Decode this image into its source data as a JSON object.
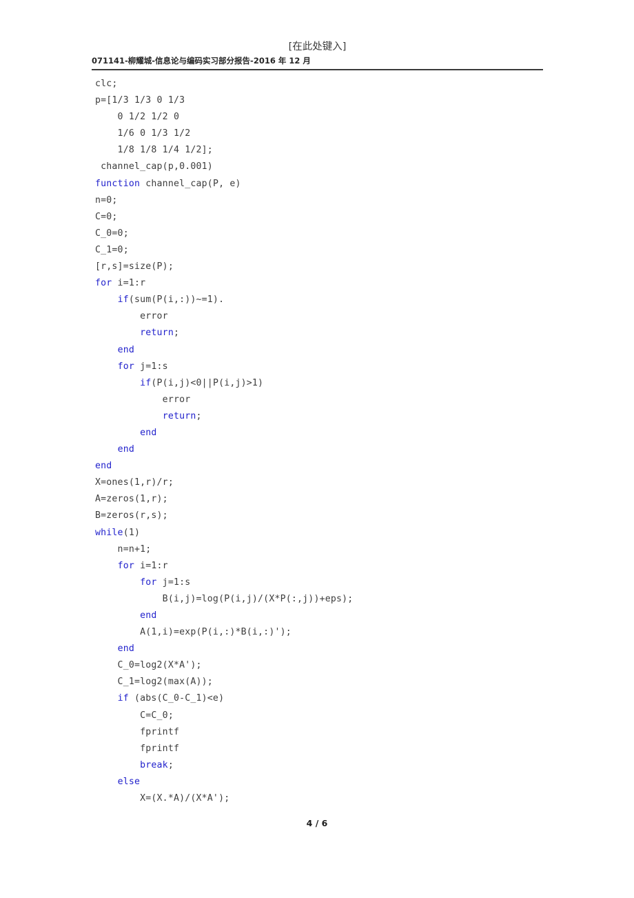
{
  "header": {
    "center_text": "[在此处键入]",
    "title_line": "071141-柳耀城-信息论与编码实习部分报告-2016 年 12 月"
  },
  "footer": {
    "page_indicator": "4 / 6"
  },
  "colors": {
    "keyword": "#2222cc",
    "text": "#3d3d3d",
    "rule": "#3a3a3a"
  },
  "code": {
    "language": "matlab",
    "lines": [
      {
        "indent": 0,
        "tokens": [
          {
            "t": "plain",
            "v": "clc;"
          }
        ]
      },
      {
        "indent": 0,
        "tokens": [
          {
            "t": "plain",
            "v": "p=[1/3 1/3 0 1/3"
          }
        ]
      },
      {
        "indent": 0,
        "tokens": [
          {
            "t": "plain",
            "v": "    0 1/2 1/2 0"
          }
        ]
      },
      {
        "indent": 0,
        "tokens": [
          {
            "t": "plain",
            "v": "    1/6 0 1/3 1/2"
          }
        ]
      },
      {
        "indent": 0,
        "tokens": [
          {
            "t": "plain",
            "v": "    1/8 1/8 1/4 1/2];"
          }
        ]
      },
      {
        "indent": 0,
        "tokens": [
          {
            "t": "plain",
            "v": " channel_cap(p,0.001)"
          }
        ]
      },
      {
        "indent": 0,
        "tokens": [
          {
            "t": "kw",
            "v": "function"
          },
          {
            "t": "plain",
            "v": " channel_cap(P, e)"
          }
        ]
      },
      {
        "indent": 0,
        "tokens": [
          {
            "t": "plain",
            "v": "n=0;"
          }
        ]
      },
      {
        "indent": 0,
        "tokens": [
          {
            "t": "plain",
            "v": "C=0;"
          }
        ]
      },
      {
        "indent": 0,
        "tokens": [
          {
            "t": "plain",
            "v": "C_0=0;"
          }
        ]
      },
      {
        "indent": 0,
        "tokens": [
          {
            "t": "plain",
            "v": "C_1=0;"
          }
        ]
      },
      {
        "indent": 0,
        "tokens": [
          {
            "t": "plain",
            "v": "[r,s]=size(P);"
          }
        ]
      },
      {
        "indent": 0,
        "tokens": [
          {
            "t": "kw",
            "v": "for"
          },
          {
            "t": "plain",
            "v": " i=1:r"
          }
        ]
      },
      {
        "indent": 0,
        "tokens": [
          {
            "t": "plain",
            "v": "    "
          },
          {
            "t": "kw",
            "v": "if"
          },
          {
            "t": "plain",
            "v": "(sum(P(i,:))~=1)."
          }
        ]
      },
      {
        "indent": 0,
        "tokens": [
          {
            "t": "plain",
            "v": "        error"
          }
        ]
      },
      {
        "indent": 0,
        "tokens": [
          {
            "t": "plain",
            "v": "        "
          },
          {
            "t": "kw",
            "v": "return"
          },
          {
            "t": "plain",
            "v": ";"
          }
        ]
      },
      {
        "indent": 0,
        "tokens": [
          {
            "t": "plain",
            "v": "    "
          },
          {
            "t": "kw",
            "v": "end"
          }
        ]
      },
      {
        "indent": 0,
        "tokens": [
          {
            "t": "plain",
            "v": "    "
          },
          {
            "t": "kw",
            "v": "for"
          },
          {
            "t": "plain",
            "v": " j=1:s"
          }
        ]
      },
      {
        "indent": 0,
        "tokens": [
          {
            "t": "plain",
            "v": "        "
          },
          {
            "t": "kw",
            "v": "if"
          },
          {
            "t": "plain",
            "v": "(P(i,j)<0||P(i,j)>1)"
          }
        ]
      },
      {
        "indent": 0,
        "tokens": [
          {
            "t": "plain",
            "v": "            error"
          }
        ]
      },
      {
        "indent": 0,
        "tokens": [
          {
            "t": "plain",
            "v": "            "
          },
          {
            "t": "kw",
            "v": "return"
          },
          {
            "t": "plain",
            "v": ";"
          }
        ]
      },
      {
        "indent": 0,
        "tokens": [
          {
            "t": "plain",
            "v": "        "
          },
          {
            "t": "kw",
            "v": "end"
          }
        ]
      },
      {
        "indent": 0,
        "tokens": [
          {
            "t": "plain",
            "v": "    "
          },
          {
            "t": "kw",
            "v": "end"
          }
        ]
      },
      {
        "indent": 0,
        "tokens": [
          {
            "t": "kw",
            "v": "end"
          }
        ]
      },
      {
        "indent": 0,
        "tokens": [
          {
            "t": "plain",
            "v": "X=ones(1,r)/r;"
          }
        ]
      },
      {
        "indent": 0,
        "tokens": [
          {
            "t": "plain",
            "v": "A=zeros(1,r);"
          }
        ]
      },
      {
        "indent": 0,
        "tokens": [
          {
            "t": "plain",
            "v": "B=zeros(r,s);"
          }
        ]
      },
      {
        "indent": 0,
        "tokens": [
          {
            "t": "kw",
            "v": "while"
          },
          {
            "t": "plain",
            "v": "(1)"
          }
        ]
      },
      {
        "indent": 0,
        "tokens": [
          {
            "t": "plain",
            "v": "    n=n+1;"
          }
        ]
      },
      {
        "indent": 0,
        "tokens": [
          {
            "t": "plain",
            "v": "    "
          },
          {
            "t": "kw",
            "v": "for"
          },
          {
            "t": "plain",
            "v": " i=1:r"
          }
        ]
      },
      {
        "indent": 0,
        "tokens": [
          {
            "t": "plain",
            "v": "        "
          },
          {
            "t": "kw",
            "v": "for"
          },
          {
            "t": "plain",
            "v": " j=1:s"
          }
        ]
      },
      {
        "indent": 0,
        "tokens": [
          {
            "t": "plain",
            "v": "            B(i,j)=log(P(i,j)/(X*P(:,j))+eps);"
          }
        ]
      },
      {
        "indent": 0,
        "tokens": [
          {
            "t": "plain",
            "v": "        "
          },
          {
            "t": "kw",
            "v": "end"
          }
        ]
      },
      {
        "indent": 0,
        "tokens": [
          {
            "t": "plain",
            "v": "        A(1,i)=exp(P(i,:)*B(i,:)');"
          }
        ]
      },
      {
        "indent": 0,
        "tokens": [
          {
            "t": "plain",
            "v": "    "
          },
          {
            "t": "kw",
            "v": "end"
          }
        ]
      },
      {
        "indent": 0,
        "tokens": [
          {
            "t": "plain",
            "v": "    C_0=log2(X*A');"
          }
        ]
      },
      {
        "indent": 0,
        "tokens": [
          {
            "t": "plain",
            "v": "    C_1=log2(max(A));"
          }
        ]
      },
      {
        "indent": 0,
        "tokens": [
          {
            "t": "plain",
            "v": "    "
          },
          {
            "t": "kw",
            "v": "if"
          },
          {
            "t": "plain",
            "v": " (abs(C_0-C_1)<e)"
          }
        ]
      },
      {
        "indent": 0,
        "tokens": [
          {
            "t": "plain",
            "v": "        C=C_0;"
          }
        ]
      },
      {
        "indent": 0,
        "tokens": [
          {
            "t": "plain",
            "v": "        fprintf"
          }
        ]
      },
      {
        "indent": 0,
        "tokens": [
          {
            "t": "plain",
            "v": "        fprintf"
          }
        ]
      },
      {
        "indent": 0,
        "tokens": [
          {
            "t": "plain",
            "v": "        "
          },
          {
            "t": "kw",
            "v": "break"
          },
          {
            "t": "plain",
            "v": ";"
          }
        ]
      },
      {
        "indent": 0,
        "tokens": [
          {
            "t": "plain",
            "v": "    "
          },
          {
            "t": "kw",
            "v": "else"
          }
        ]
      },
      {
        "indent": 0,
        "tokens": [
          {
            "t": "plain",
            "v": "        X=(X.*A)/(X*A');"
          }
        ]
      }
    ]
  }
}
